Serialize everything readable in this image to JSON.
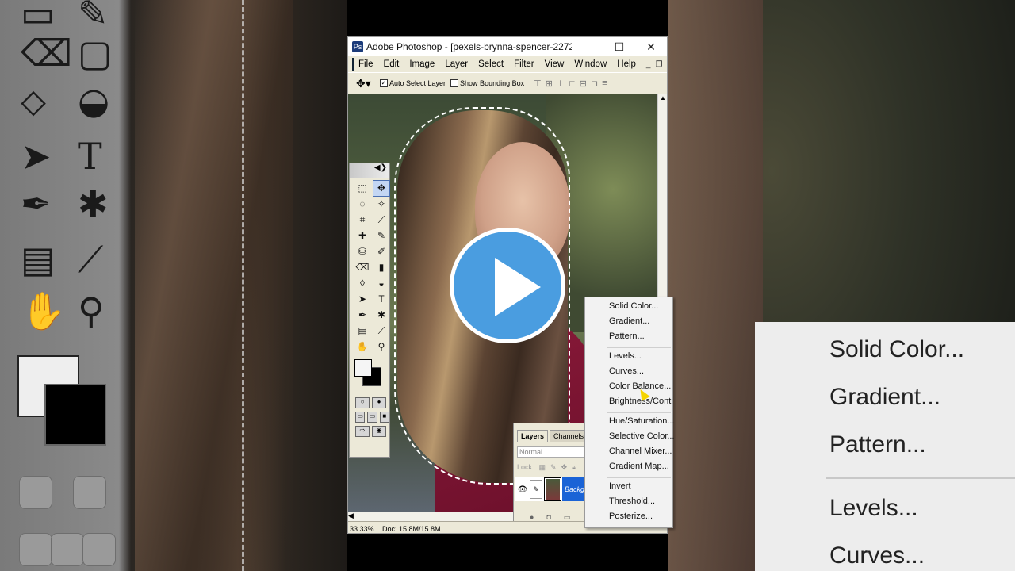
{
  "window": {
    "title": "Adobe Photoshop - [pexels-brynna-spencer-227289.jpg ...",
    "controls": [
      "—",
      "☐",
      "✕"
    ]
  },
  "menubar": [
    "File",
    "Edit",
    "Image",
    "Layer",
    "Select",
    "Filter",
    "View",
    "Window",
    "Help"
  ],
  "options": {
    "auto_select_label": "Auto Select Layer",
    "auto_select_checked": true,
    "bounding_box_label": "Show Bounding Box",
    "bounding_box_checked": false
  },
  "status": {
    "zoom": "33.33%",
    "doc": "Doc: 15.8M/15.8M"
  },
  "layers_panel": {
    "tabs": [
      "Layers",
      "Channels"
    ],
    "blend_mode": "Normal",
    "lock_label": "Lock:",
    "layer_name": "Backgr"
  },
  "context_menu": {
    "group1": [
      "Solid Color...",
      "Gradient...",
      "Pattern..."
    ],
    "group2": [
      "Levels...",
      "Curves...",
      "Color Balance...",
      "Brightness/Cont"
    ],
    "group3": [
      "Hue/Saturation...",
      "Selective Color...",
      "Channel Mixer...",
      "Gradient Map..."
    ],
    "group4": [
      "Invert",
      "Threshold...",
      "Posterize..."
    ]
  },
  "zoomed_menu": [
    "Solid Color...",
    "Gradient...",
    "Pattern...",
    "Levels...",
    "Curves..."
  ],
  "colors": {
    "play_button": "#4a9de0",
    "selection_highlight": "#1a63d6",
    "foreground_swatch": "#f5f5f5",
    "background_swatch": "#000000"
  }
}
